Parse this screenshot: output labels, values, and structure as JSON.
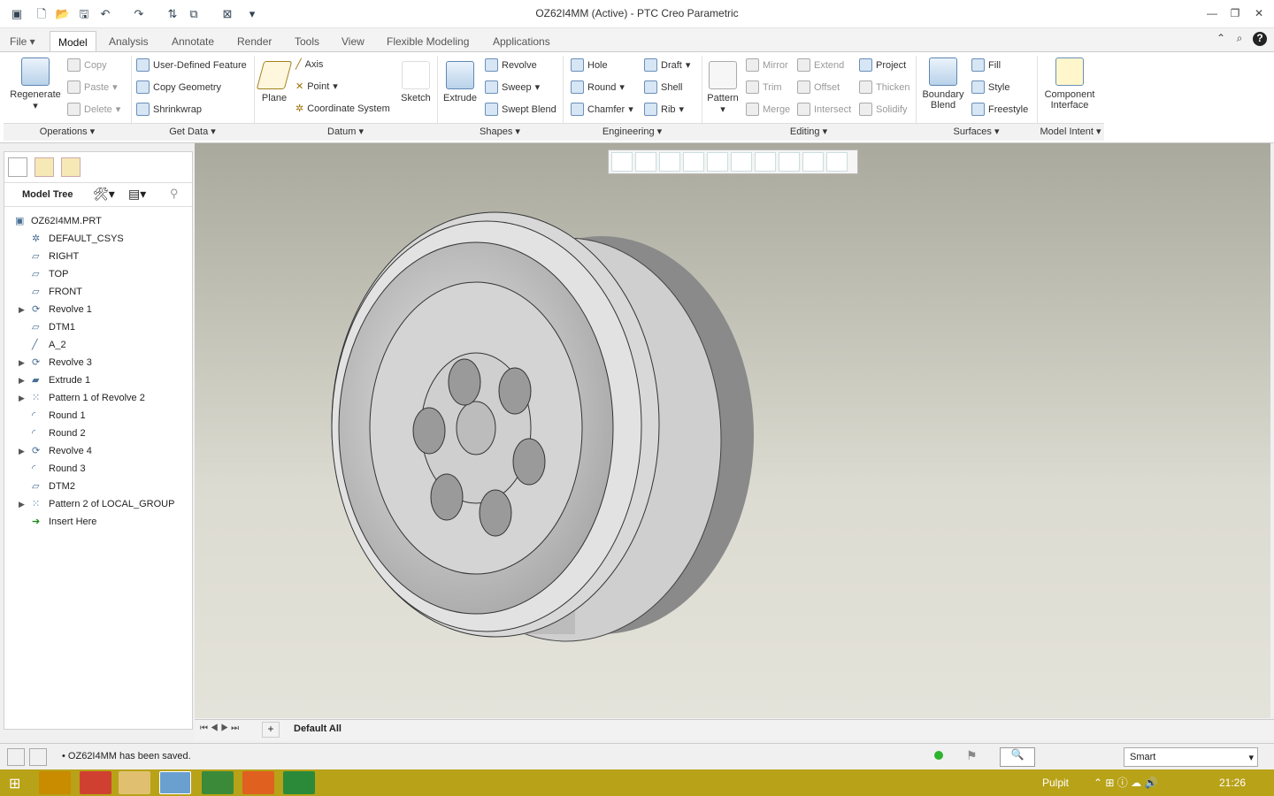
{
  "window": {
    "title": "OZ62I4MM (Active) - PTC Creo Parametric"
  },
  "tabs": [
    "File",
    "Model",
    "Analysis",
    "Annotate",
    "Render",
    "Tools",
    "View",
    "Flexible Modeling",
    "Applications"
  ],
  "ribbon": {
    "regenerate": "Regenerate",
    "copy": "Copy",
    "paste": "Paste",
    "delete": "Delete",
    "udf": "User-Defined Feature",
    "copy_geometry": "Copy Geometry",
    "shrinkwrap": "Shrinkwrap",
    "plane": "Plane",
    "axis": "Axis",
    "point": "Point",
    "coord_sys": "Coordinate System",
    "sketch": "Sketch",
    "extrude": "Extrude",
    "revolve": "Revolve",
    "sweep": "Sweep",
    "swept_blend": "Swept Blend",
    "hole": "Hole",
    "round": "Round",
    "chamfer": "Chamfer",
    "draft": "Draft",
    "shell": "Shell",
    "rib": "Rib",
    "pattern": "Pattern",
    "mirror": "Mirror",
    "trim": "Trim",
    "merge": "Merge",
    "extend": "Extend",
    "offset": "Offset",
    "intersect": "Intersect",
    "project": "Project",
    "thicken": "Thicken",
    "solidify": "Solidify",
    "boundary_blend_1": "Boundary",
    "boundary_blend_2": "Blend",
    "fill": "Fill",
    "style": "Style",
    "freestyle": "Freestyle",
    "component_interface_1": "Component",
    "component_interface_2": "Interface",
    "groups": [
      "Operations",
      "Get Data",
      "Datum",
      "Shapes",
      "Engineering",
      "Editing",
      "Surfaces",
      "Model Intent"
    ]
  },
  "model_tree": {
    "header": "Model Tree",
    "items": [
      {
        "label": "OZ62I4MM.PRT",
        "icon": "part-icon",
        "expand": false
      },
      {
        "label": "DEFAULT_CSYS",
        "icon": "csys-icon",
        "expand": false
      },
      {
        "label": "RIGHT",
        "icon": "plane-icon",
        "expand": false
      },
      {
        "label": "TOP",
        "icon": "plane-icon",
        "expand": false
      },
      {
        "label": "FRONT",
        "icon": "plane-icon",
        "expand": false
      },
      {
        "label": "Revolve 1",
        "icon": "revolve-icon",
        "expand": true
      },
      {
        "label": "DTM1",
        "icon": "plane-icon",
        "expand": false
      },
      {
        "label": "A_2",
        "icon": "axis-icon",
        "expand": false
      },
      {
        "label": "Revolve 3",
        "icon": "revolve-icon",
        "expand": true
      },
      {
        "label": "Extrude 1",
        "icon": "extrude-icon",
        "expand": true
      },
      {
        "label": "Pattern 1 of Revolve 2",
        "icon": "pattern-icon",
        "expand": true
      },
      {
        "label": "Round 1",
        "icon": "round-icon",
        "expand": false
      },
      {
        "label": "Round 2",
        "icon": "round-icon",
        "expand": false
      },
      {
        "label": "Revolve 4",
        "icon": "revolve-icon",
        "expand": true
      },
      {
        "label": "Round 3",
        "icon": "round-icon",
        "expand": false
      },
      {
        "label": "DTM2",
        "icon": "plane-icon",
        "expand": false
      },
      {
        "label": "Pattern 2 of LOCAL_GROUP",
        "icon": "pattern-icon",
        "expand": true
      },
      {
        "label": "Insert Here",
        "icon": "insert-arrow-icon",
        "expand": false
      }
    ]
  },
  "bottombar": {
    "layer": "Default All"
  },
  "status": {
    "message": "OZ62I4MM has been saved.",
    "filter": "Smart"
  },
  "taskbar": {
    "pulpit": "Pulpit",
    "time": "21:26"
  }
}
